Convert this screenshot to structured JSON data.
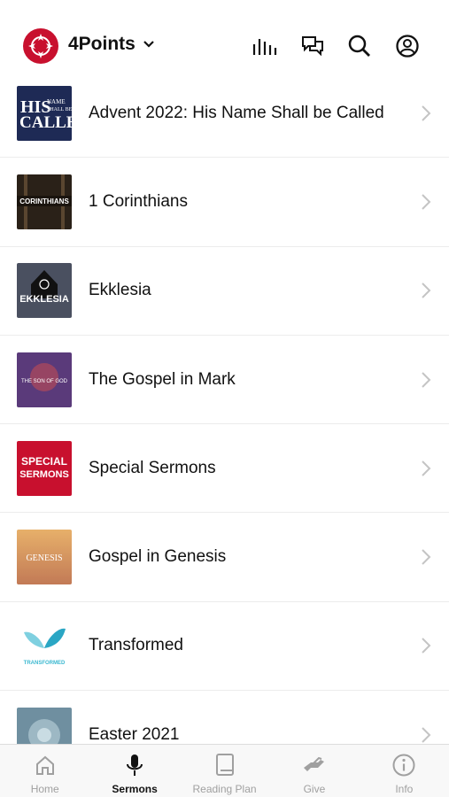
{
  "header": {
    "org_name": "4Points",
    "icons": [
      "logo-icon",
      "chevron-down-icon",
      "audio-bars-icon",
      "chat-icon",
      "search-icon",
      "account-icon"
    ]
  },
  "series": [
    {
      "title": "Advent 2022: His Name Shall be Called",
      "thumb_text": "HIS NAME SHALL BE CALLED",
      "color": "#1e2a55"
    },
    {
      "title": "1 Corinthians",
      "thumb_text": "CORINTHIANS",
      "color": "#2a2118"
    },
    {
      "title": "Ekklesia",
      "thumb_text": "EKKLESIA",
      "color": "#4a5060"
    },
    {
      "title": "The Gospel in Mark",
      "thumb_text": "THE SON OF GOD",
      "color": "#5a3a7a"
    },
    {
      "title": "Special Sermons",
      "thumb_text": "SPECIAL SERMONS",
      "color": "#c8102e"
    },
    {
      "title": "Gospel in Genesis",
      "thumb_text": "GENESIS",
      "color": "#d9935a"
    },
    {
      "title": "Transformed",
      "thumb_text": "TRANSFORMED",
      "color": "#3bb8d0"
    },
    {
      "title": "Easter 2021",
      "thumb_text": "",
      "color": "#6f8fa0"
    }
  ],
  "tabs": [
    {
      "label": "Home",
      "icon": "home-icon",
      "active": false
    },
    {
      "label": "Sermons",
      "icon": "microphone-icon",
      "active": true
    },
    {
      "label": "Reading Plan",
      "icon": "book-icon",
      "active": false
    },
    {
      "label": "Give",
      "icon": "give-hand-icon",
      "active": false
    },
    {
      "label": "Info",
      "icon": "info-icon",
      "active": false
    }
  ],
  "colors": {
    "brand": "#c8102e",
    "active_tab": "#111111",
    "inactive_tab": "#a0a0a0"
  }
}
